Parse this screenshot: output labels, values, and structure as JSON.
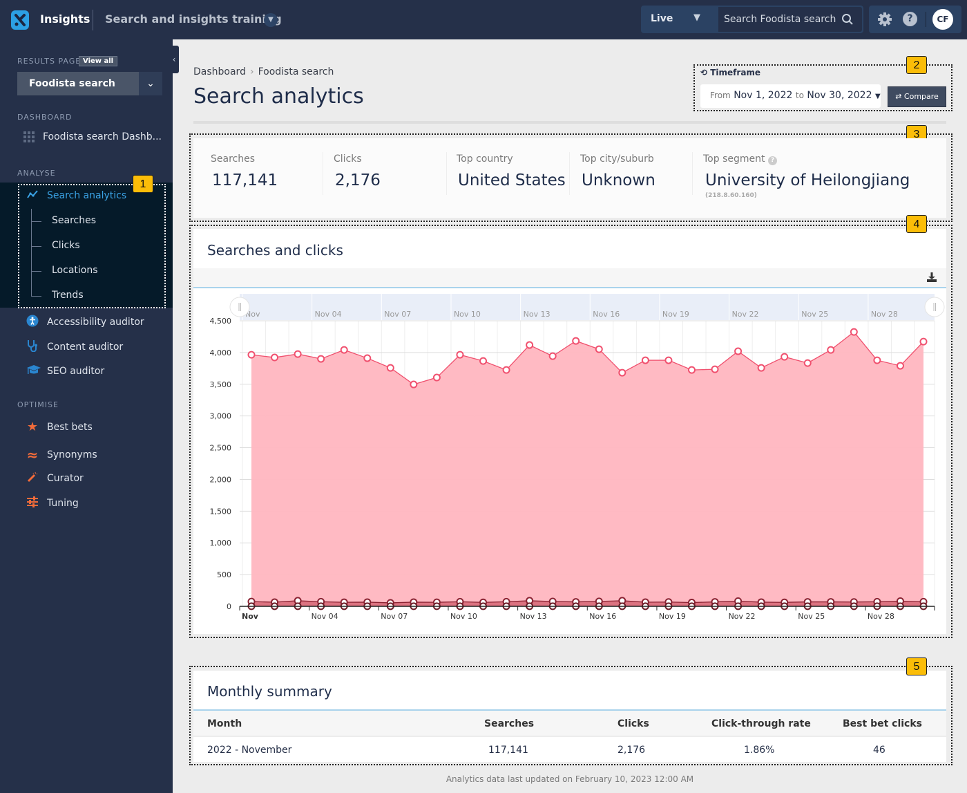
{
  "topbar": {
    "app_name": "Insights",
    "project_name": "Search and insights training",
    "environment": "Live",
    "search_placeholder": "Search Foodista search",
    "help_glyph": "?",
    "avatar_initials": "CF"
  },
  "sidebar": {
    "results_page_label": "RESULTS PAGE",
    "view_all_label": "View all",
    "selected_results_page": "Foodista search",
    "dashboard_label": "DASHBOARD",
    "dashboard_item": "Foodista search Dashb...",
    "analyse_label": "ANALYSE",
    "analyse_items": [
      {
        "label": "Search analytics",
        "icon": "line-chart-icon",
        "active": true
      },
      {
        "label": "Accessibility auditor",
        "icon": "accessibility-icon"
      },
      {
        "label": "Content auditor",
        "icon": "stethoscope-icon"
      },
      {
        "label": "SEO auditor",
        "icon": "graduation-cap-icon"
      }
    ],
    "search_analytics_sub": [
      "Searches",
      "Clicks",
      "Locations",
      "Trends"
    ],
    "optimise_label": "OPTIMISE",
    "optimise_items": [
      {
        "label": "Best bets",
        "icon": "star-icon"
      },
      {
        "label": "Synonyms",
        "icon": "approx-icon"
      },
      {
        "label": "Curator",
        "icon": "magic-wand-icon"
      },
      {
        "label": "Tuning",
        "icon": "sliders-icon"
      }
    ]
  },
  "header": {
    "breadcrumb": [
      "Dashboard",
      "Foodista search"
    ],
    "breadcrumb_sep": "›",
    "title": "Search analytics"
  },
  "timeframe": {
    "label": "Timeframe",
    "from_word": "From",
    "from_date": "Nov 1, 2022",
    "to_word": "to",
    "to_date": "Nov 30, 2022",
    "compare_label": "Compare"
  },
  "stats": [
    {
      "label": "Searches",
      "value": "117,141"
    },
    {
      "label": "Clicks",
      "value": "2,176"
    },
    {
      "label": "Top country",
      "value": "United States"
    },
    {
      "label": "Top city/suburb",
      "value": "Unknown"
    },
    {
      "label": "Top segment",
      "value": "University of Heilongjiang",
      "sub": "(218.8.60.160)"
    }
  ],
  "markers": [
    "1",
    "2",
    "3",
    "4",
    "5"
  ],
  "chart_section": {
    "title": "Searches and clicks"
  },
  "chart_data": {
    "type": "area",
    "title": "Searches and clicks",
    "x": [
      "Nov 1",
      "Nov 2",
      "Nov 3",
      "Nov 4",
      "Nov 5",
      "Nov 6",
      "Nov 7",
      "Nov 8",
      "Nov 9",
      "Nov 10",
      "Nov 11",
      "Nov 12",
      "Nov 13",
      "Nov 14",
      "Nov 15",
      "Nov 16",
      "Nov 17",
      "Nov 18",
      "Nov 19",
      "Nov 20",
      "Nov 21",
      "Nov 22",
      "Nov 23",
      "Nov 24",
      "Nov 25",
      "Nov 26",
      "Nov 27",
      "Nov 28",
      "Nov 29",
      "Nov 30"
    ],
    "x_tick_labels": [
      "Nov",
      "Nov 04",
      "Nov 07",
      "Nov 10",
      "Nov 13",
      "Nov 16",
      "Nov 19",
      "Nov 22",
      "Nov 25",
      "Nov 28"
    ],
    "x_tick_indices": [
      0,
      3,
      6,
      9,
      12,
      15,
      18,
      21,
      24,
      27
    ],
    "navigator_labels": [
      "Nov",
      "Nov 04",
      "Nov 07",
      "Nov 10",
      "Nov 13",
      "Nov 16",
      "Nov 19",
      "Nov 22",
      "Nov 25",
      "Nov 28"
    ],
    "series": [
      {
        "name": "Searches",
        "color": "#f0506e",
        "fill": "#ffb6c0",
        "values": [
          3965,
          3922,
          3976,
          3900,
          4041,
          3911,
          3758,
          3497,
          3606,
          3965,
          3867,
          3725,
          4118,
          3943,
          4183,
          4052,
          3682,
          3878,
          3878,
          3725,
          3736,
          4020,
          3758,
          3932,
          3834,
          4041,
          4324,
          3878,
          3791,
          4172
        ]
      },
      {
        "name": "Clicks",
        "color": "#8b2232",
        "fill": "#d86b7a",
        "values": [
          75,
          65,
          88,
          72,
          64,
          66,
          55,
          66,
          64,
          72,
          63,
          72,
          88,
          76,
          70,
          78,
          88,
          65,
          68,
          60,
          70,
          82,
          66,
          63,
          70,
          70,
          68,
          72,
          82,
          72
        ]
      },
      {
        "name": "Best bet clicks",
        "color": "#6e1f2a",
        "values": [
          1,
          2,
          2,
          1,
          2,
          1,
          2,
          1,
          2,
          1,
          1,
          2,
          2,
          1,
          2,
          2,
          2,
          1,
          2,
          1,
          2,
          2,
          1,
          1,
          2,
          2,
          1,
          2,
          2,
          1
        ]
      }
    ],
    "ylim": [
      0,
      4500
    ],
    "y_ticks": [
      0,
      500,
      1000,
      1500,
      2000,
      2500,
      3000,
      3500,
      4000,
      4500
    ],
    "y_tick_labels": [
      "0",
      "500",
      "1,000",
      "1,500",
      "2,000",
      "2,500",
      "3,000",
      "3,500",
      "4,000",
      "4,500"
    ],
    "grid": true,
    "legend": "none"
  },
  "summary": {
    "title": "Monthly summary",
    "columns": [
      "Month",
      "Searches",
      "Clicks",
      "Click-through rate",
      "Best bet clicks"
    ],
    "rows": [
      [
        "2022 - November",
        "117,141",
        "2,176",
        "1.86%",
        "46"
      ]
    ]
  },
  "footer": {
    "text": "Analytics data last updated on February 10, 2023 12:00 AM"
  }
}
